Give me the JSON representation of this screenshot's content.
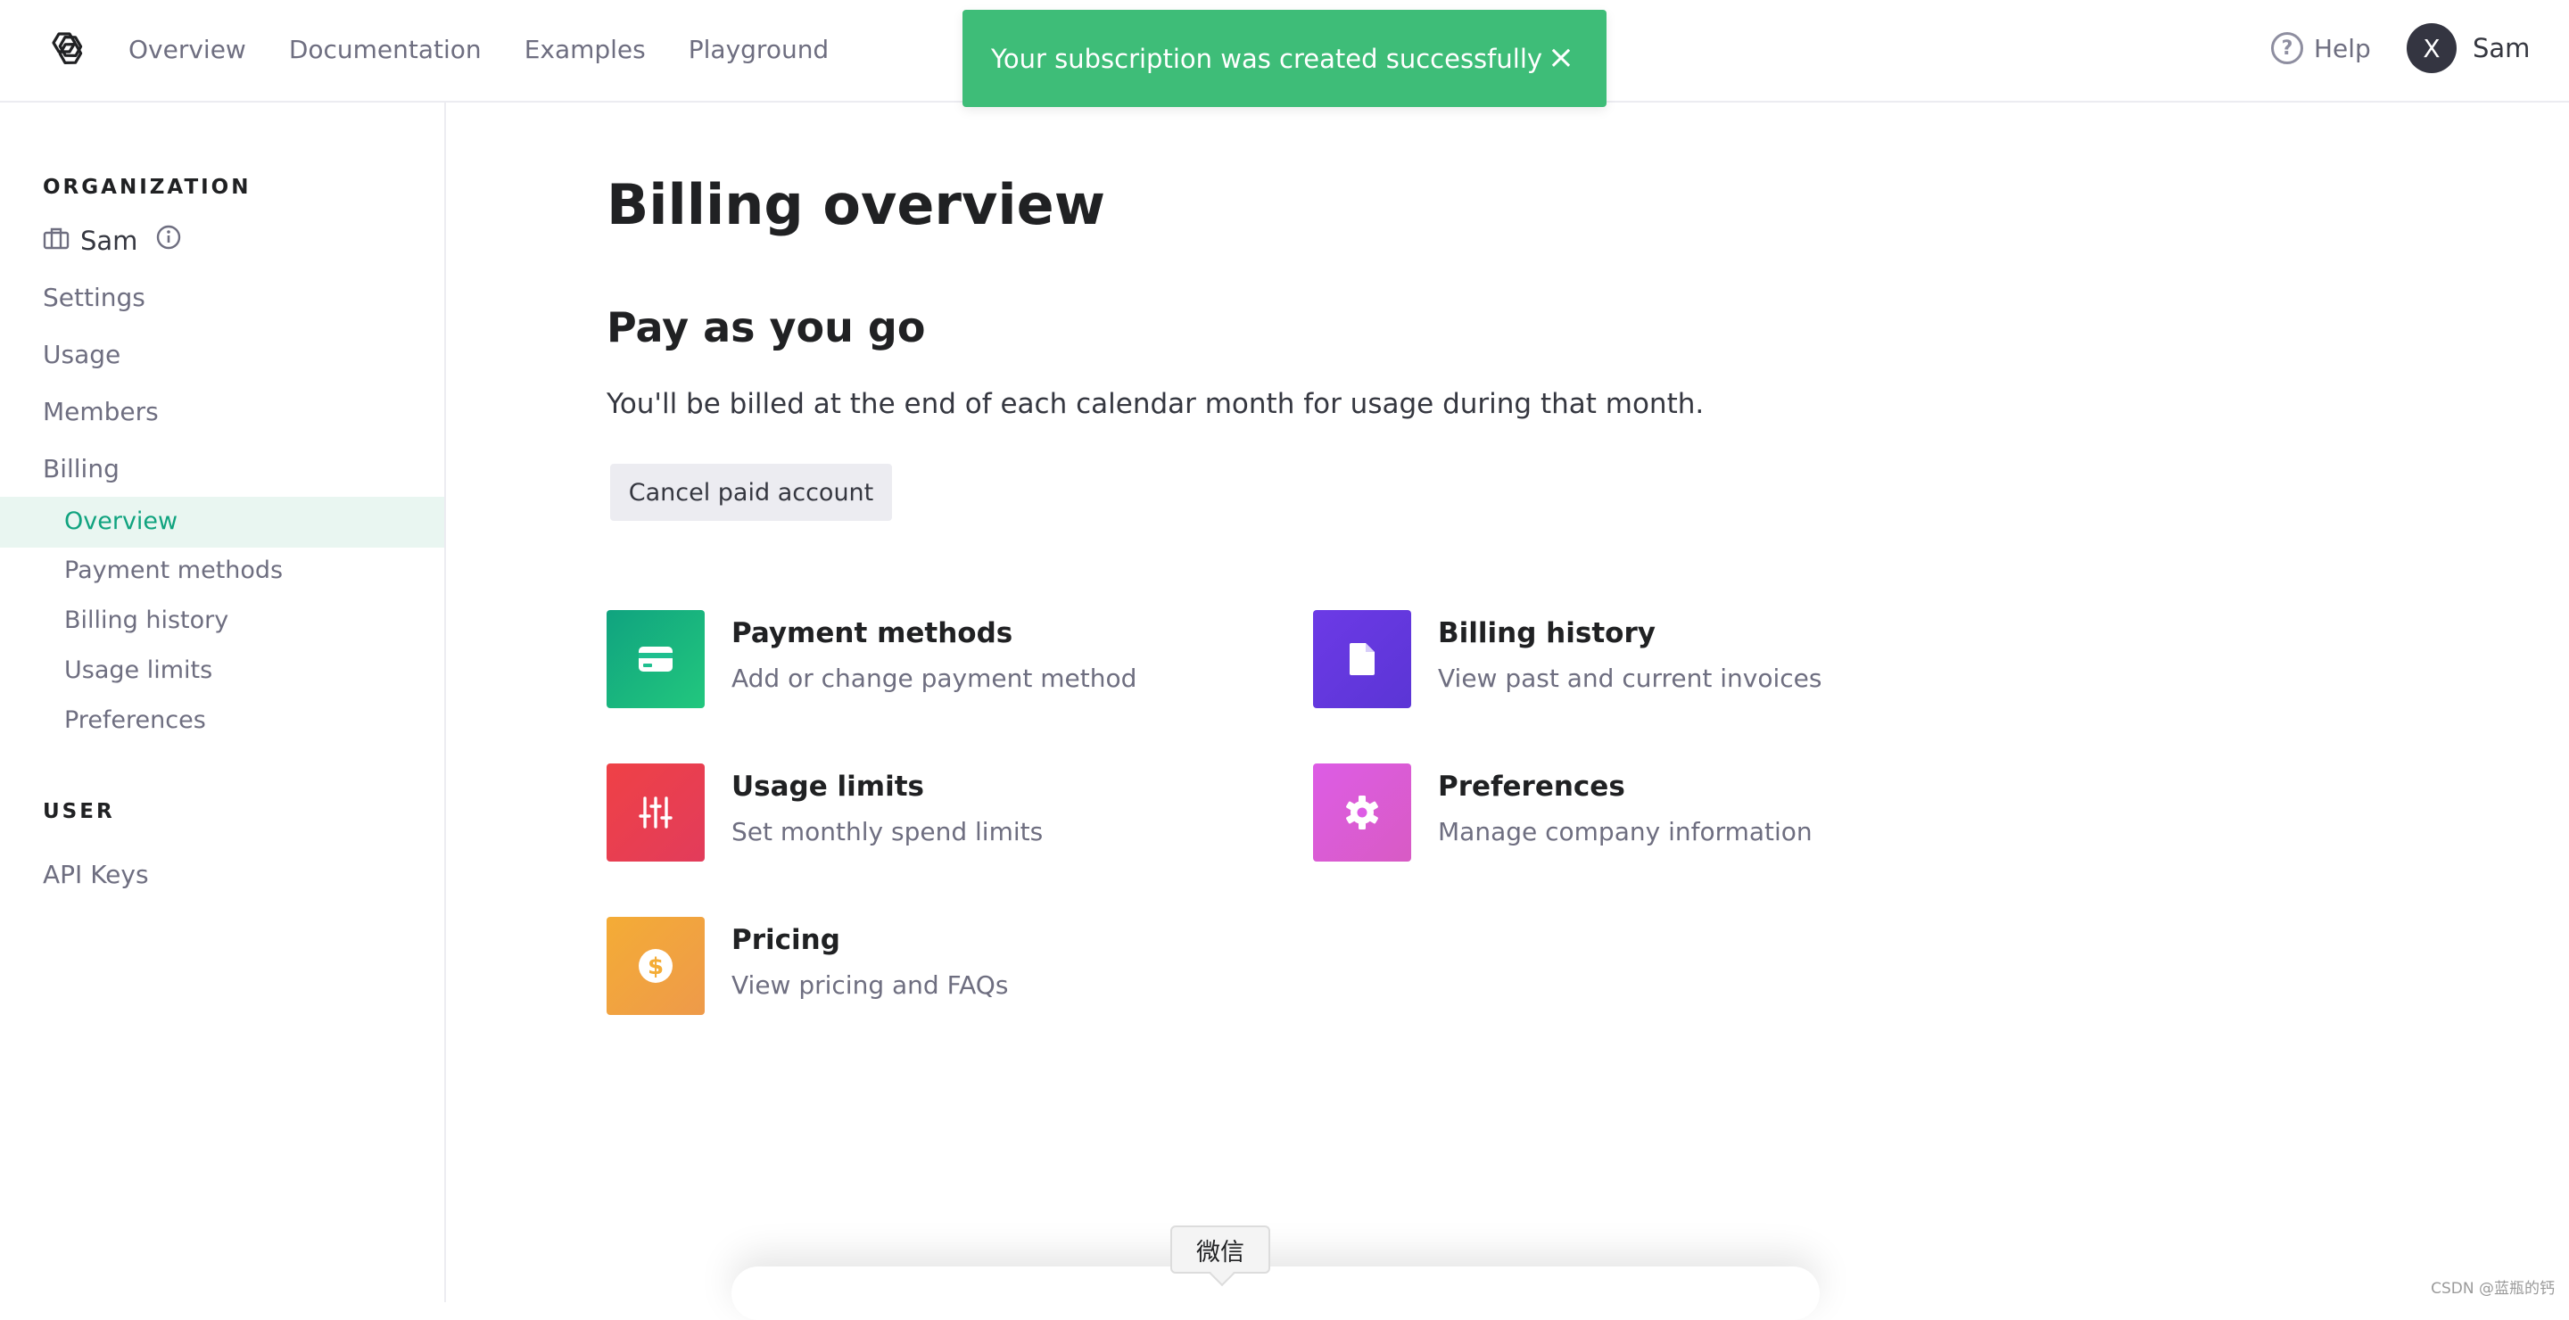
{
  "header": {
    "logo_icon": "openai-logo-icon",
    "nav": [
      "Overview",
      "Documentation",
      "Examples",
      "Playground"
    ],
    "help_label": "Help",
    "help_icon": "question-circle-icon",
    "user_initial": "X",
    "user_name": "Sam"
  },
  "toast": {
    "message": "Your subscription was created successfully",
    "close_label": "×",
    "color": "#3ebd78"
  },
  "sidebar": {
    "org_heading": "ORGANIZATION",
    "org_name": "Sam",
    "org_icon": "briefcase-icon",
    "org_info_icon": "info-icon",
    "items": [
      "Settings",
      "Usage",
      "Members",
      "Billing"
    ],
    "billing_sub": [
      "Overview",
      "Payment methods",
      "Billing history",
      "Usage limits",
      "Preferences"
    ],
    "active_sub": "Overview",
    "user_heading": "USER",
    "user_items": [
      "API Keys"
    ],
    "active_color": "#10a37f"
  },
  "main": {
    "title": "Billing overview",
    "plan_title": "Pay as you go",
    "plan_desc": "You'll be billed at the end of each calendar month for usage during that month.",
    "cancel_button": "Cancel paid account",
    "cards": [
      {
        "title": "Payment methods",
        "subtitle": "Add or change payment method",
        "icon": "credit-card-icon",
        "color": "#1fbf8f"
      },
      {
        "title": "Billing history",
        "subtitle": "View past and current invoices",
        "icon": "document-icon",
        "color": "#6c3ae6"
      },
      {
        "title": "Usage limits",
        "subtitle": "Set monthly spend limits",
        "icon": "sliders-icon",
        "color": "#ef4146"
      },
      {
        "title": "Preferences",
        "subtitle": "Manage company information",
        "icon": "gear-icon",
        "color": "#dd5ce5"
      },
      {
        "title": "Pricing",
        "subtitle": "View pricing and FAQs",
        "icon": "dollar-circle-icon",
        "color": "#f4ac36"
      }
    ]
  },
  "overlay": {
    "wechat_tooltip": "微信",
    "watermark": "CSDN @蓝瓶的钙"
  }
}
